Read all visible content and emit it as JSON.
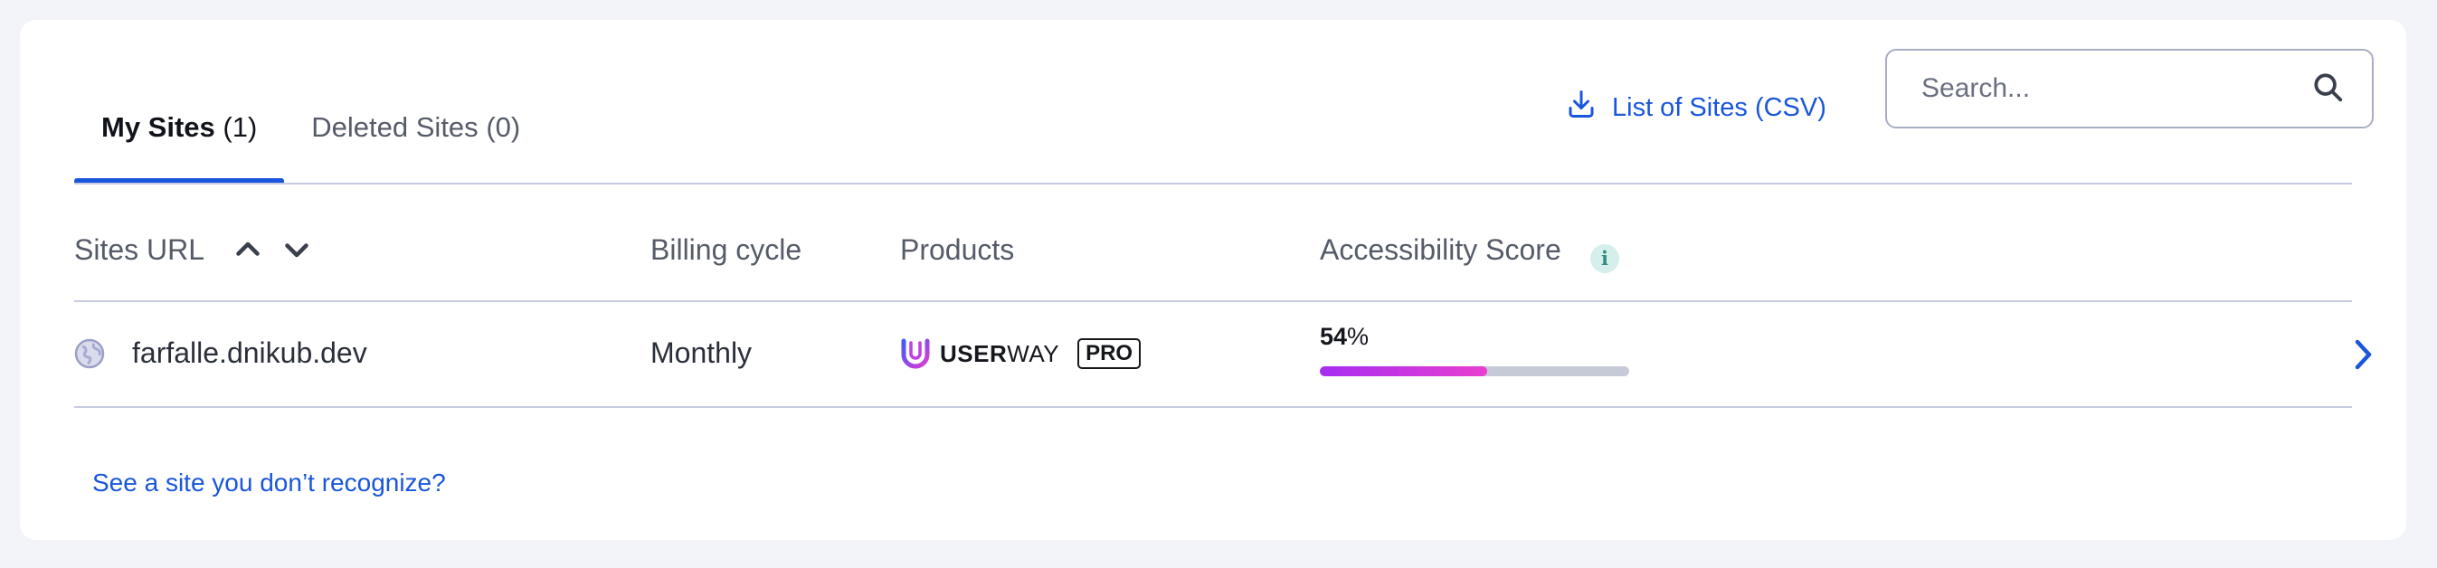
{
  "tabs": [
    {
      "name": "My Sites",
      "count": "(1)",
      "active": true
    },
    {
      "name": "Deleted Sites",
      "count": "(0)",
      "active": false
    }
  ],
  "toolbar": {
    "csv_label": "List of Sites (CSV)",
    "csv_icon": "download-icon",
    "search_placeholder": "Search...",
    "search_icon": "search-icon"
  },
  "table": {
    "headers": {
      "url": "Sites URL",
      "billing": "Billing cycle",
      "products": "Products",
      "score": "Accessibility Score"
    },
    "info_icon_glyph": "i",
    "rows": [
      {
        "url": "farfalle.dnikub.dev",
        "billing": "Monthly",
        "product": {
          "brand_bold": "USER",
          "brand_light": "WAY",
          "badge": "PRO"
        },
        "score": {
          "value": "54",
          "unit": "%",
          "fraction": 0.54
        }
      }
    ]
  },
  "footer": {
    "link": "See a site you don’t recognize?"
  },
  "colors": {
    "accent": "#1a56db",
    "progress_start": "#a62df0",
    "progress_end": "#e83fd0",
    "info_badge_bg": "#d6efec"
  }
}
